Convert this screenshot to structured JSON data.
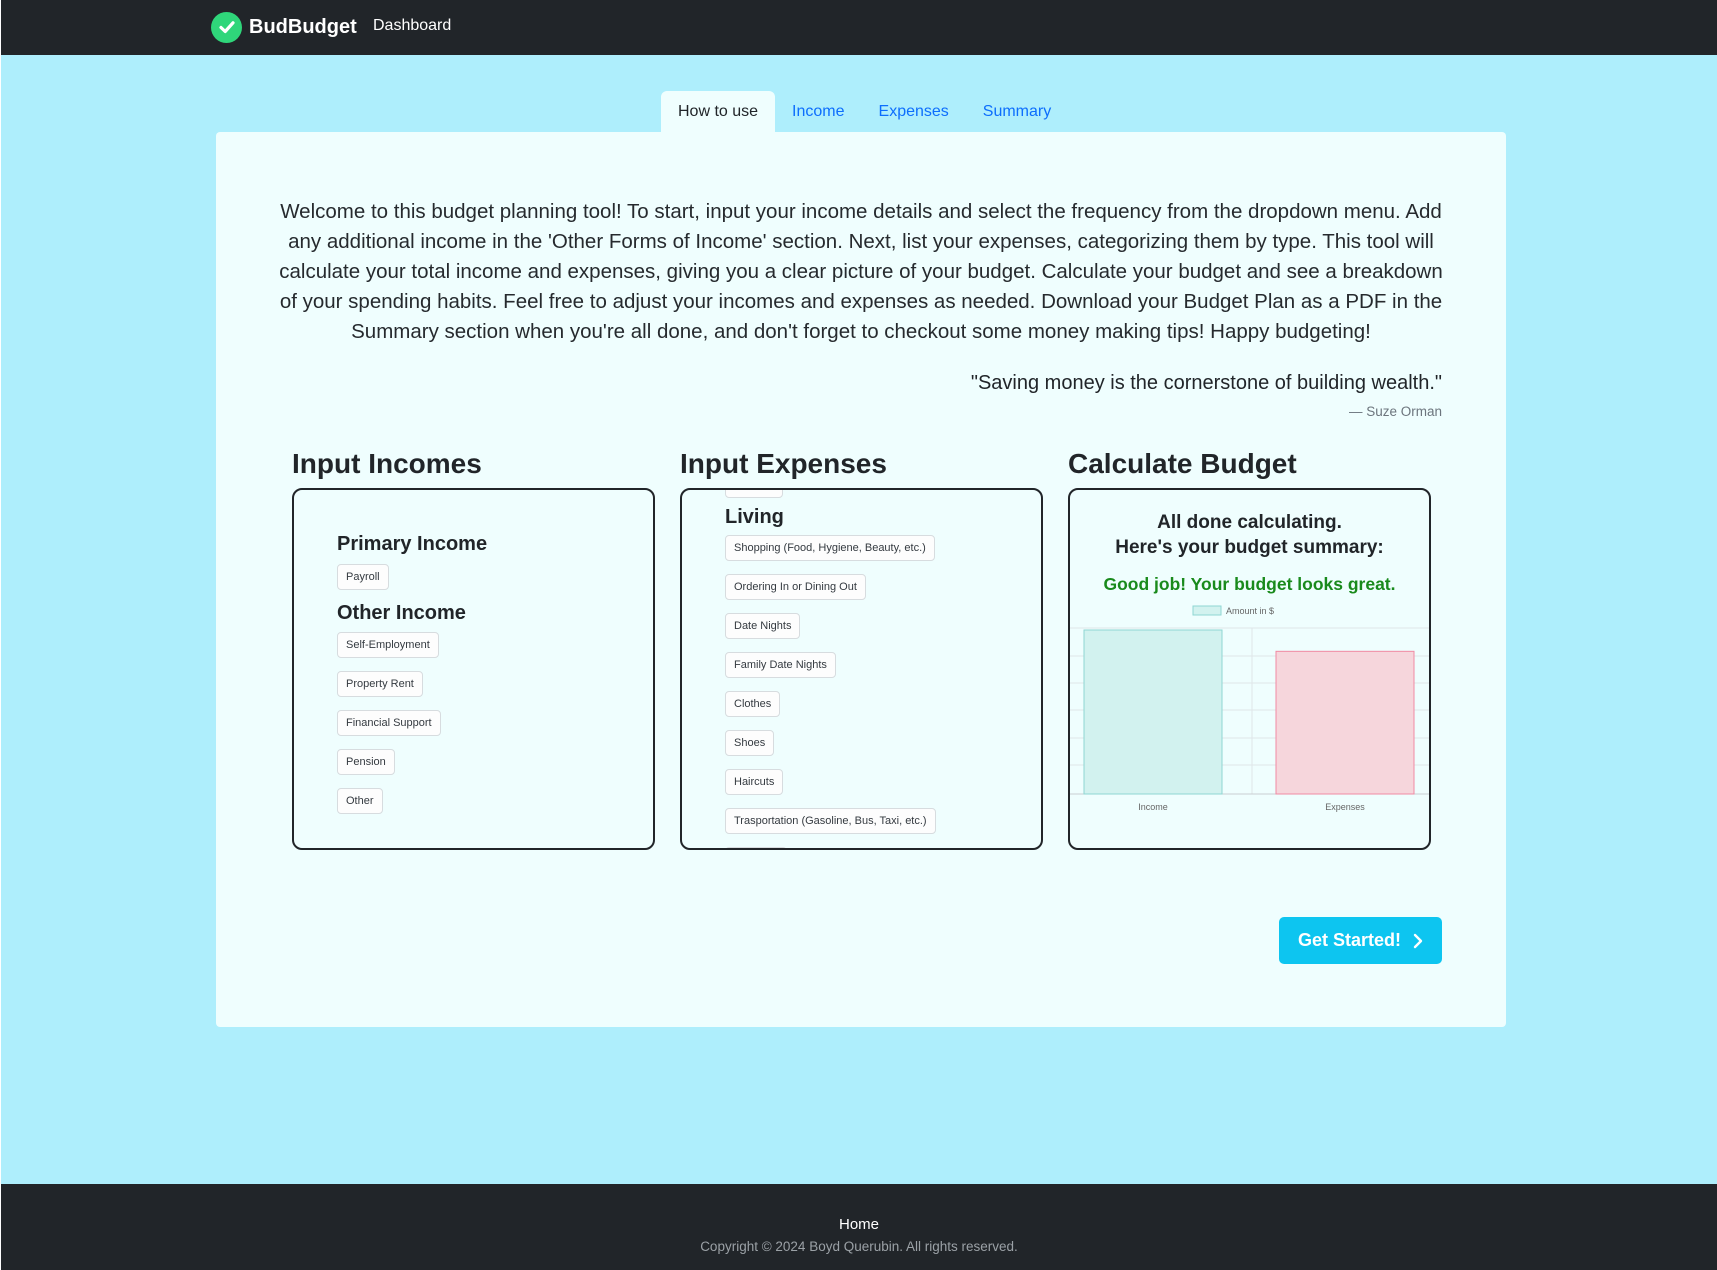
{
  "navbar": {
    "brand": "BudBudget",
    "links": [
      "Dashboard"
    ]
  },
  "tabs": [
    {
      "label": "How to use",
      "active": true
    },
    {
      "label": "Income",
      "active": false
    },
    {
      "label": "Expenses",
      "active": false
    },
    {
      "label": "Summary",
      "active": false
    }
  ],
  "intro": {
    "text": "Welcome to this budget planning tool! To start, input your income details and select the frequency from the dropdown menu. Add any additional income in the 'Other Forms of Income' section. Next, list your expenses, categorizing them by type. This tool will calculate your total income and expenses, giving you a clear picture of your budget. Calculate your budget and see a breakdown of your spending habits. Feel free to adjust your incomes and expenses as needed. Download your Budget Plan as a PDF in the Summary section when you're all done, and don't forget to checkout some money making tips! Happy budgeting!",
    "quote": "\"Saving money is the cornerstone of building wealth.\"",
    "author": "— Suze Orman"
  },
  "steps": {
    "incomes": {
      "title": "Input Incomes",
      "primary_heading": "Primary Income",
      "primary_items": [
        "Payroll"
      ],
      "other_heading": "Other Income",
      "other_items": [
        "Self-Employment",
        "Property Rent",
        "Financial Support",
        "Pension",
        "Other"
      ]
    },
    "expenses": {
      "title": "Input Expenses",
      "heading": "Living",
      "items": [
        "Shopping (Food, Hygiene, Beauty, etc.)",
        "Ordering In or Dining Out",
        "Date Nights",
        "Family Date Nights",
        "Clothes",
        "Shoes",
        "Haircuts",
        "Trasportation (Gasoline, Bus, Taxi, etc.)"
      ]
    },
    "calculate": {
      "title": "Calculate Budget",
      "summary_line1": "All done calculating.",
      "summary_line2": "Here's your budget summary:",
      "good_message": "Good job! Your budget looks great."
    }
  },
  "chart_data": {
    "type": "bar",
    "categories": [
      "Income",
      "Expenses"
    ],
    "series": [
      {
        "name": "Amount in $",
        "values": [
          100,
          87
        ]
      }
    ],
    "colors": {
      "bars": [
        "#d2f2ef",
        "#f6d6dc"
      ],
      "borders": [
        "#8fd6d3",
        "#f08aa3"
      ]
    },
    "grid": true,
    "legend": "top"
  },
  "cta": {
    "label": "Get Started!"
  },
  "footer": {
    "link": "Home",
    "copyright": "Copyright © 2024 Boyd Querubin. All rights reserved."
  },
  "icons": {
    "brand": "check-circle-icon",
    "cta": "chevron-right-icon"
  }
}
